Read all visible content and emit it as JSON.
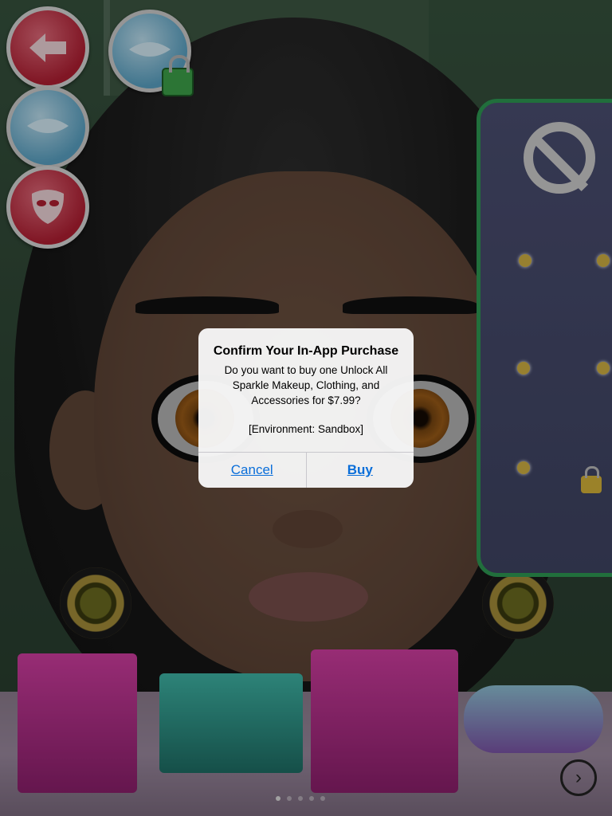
{
  "dialog": {
    "title": "Confirm Your In-App Purchase",
    "message": "Do you want to buy one Unlock All Sparkle Makeup, Clothing, and Accessories for $7.99?",
    "environment": "[Environment: Sandbox]",
    "cancel_label": "Cancel",
    "buy_label": "Buy"
  },
  "toolbar": {
    "icons": [
      "back-arrow-icon",
      "lips-makeup-icon",
      "lock-icon",
      "face-mask-icon"
    ]
  },
  "side_panel": {
    "icons": [
      "no-symbol-icon",
      "lock-icon"
    ]
  },
  "shelf": {
    "items": [
      "earring-jewelry-box",
      "tiara-jewelry-box",
      "necklace-jewelry-box",
      "contact-lens-case"
    ],
    "next_icon": "next-arrow-icon"
  },
  "pagination": {
    "pages": 5,
    "current": 1
  },
  "colors": {
    "accent_link": "#0a6ed9",
    "panel_border": "#2f9a54"
  }
}
